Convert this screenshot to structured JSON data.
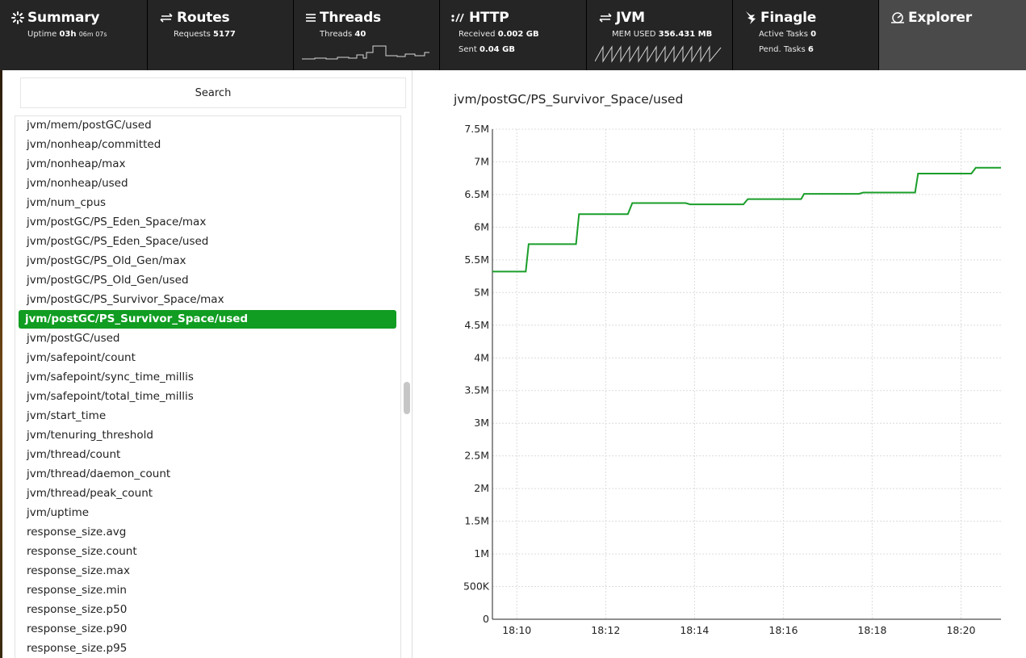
{
  "nav": {
    "summary": {
      "title": "Summary",
      "uptime_label": "Uptime",
      "uptime_main": "03h",
      "uptime_sub": "06m 07s"
    },
    "routes": {
      "title": "Routes",
      "requests_label": "Requests",
      "requests_value": "5177"
    },
    "threads": {
      "title": "Threads",
      "threads_label": "Threads",
      "threads_value": "40"
    },
    "http": {
      "title": "HTTP",
      "received_label": "Received",
      "received_value": "0.002 GB",
      "sent_label": "Sent",
      "sent_value": "0.04 GB"
    },
    "jvm": {
      "title": "JVM",
      "mem_label": "MEM USED",
      "mem_value": "356.431 MB"
    },
    "finagle": {
      "title": "Finagle",
      "active_label": "Active Tasks",
      "active_value": "0",
      "pend_label": "Pend. Tasks",
      "pend_value": "6"
    },
    "explorer": {
      "title": "Explorer"
    }
  },
  "search": {
    "placeholder": "Search"
  },
  "metrics": [
    "jvm/mem/postGC/used",
    "jvm/nonheap/committed",
    "jvm/nonheap/max",
    "jvm/nonheap/used",
    "jvm/num_cpus",
    "jvm/postGC/PS_Eden_Space/max",
    "jvm/postGC/PS_Eden_Space/used",
    "jvm/postGC/PS_Old_Gen/max",
    "jvm/postGC/PS_Old_Gen/used",
    "jvm/postGC/PS_Survivor_Space/max",
    "jvm/postGC/PS_Survivor_Space/used",
    "jvm/postGC/used",
    "jvm/safepoint/count",
    "jvm/safepoint/sync_time_millis",
    "jvm/safepoint/total_time_millis",
    "jvm/start_time",
    "jvm/tenuring_threshold",
    "jvm/thread/count",
    "jvm/thread/daemon_count",
    "jvm/thread/peak_count",
    "jvm/uptime",
    "response_size.avg",
    "response_size.count",
    "response_size.max",
    "response_size.min",
    "response_size.p50",
    "response_size.p90",
    "response_size.p95"
  ],
  "selected_metric": "jvm/postGC/PS_Survivor_Space/used",
  "colors": {
    "accent": "#109d22",
    "line": "#1a9e2a",
    "nav_bg": "#252525",
    "nav_active": "#4a4a4a"
  },
  "chart_data": {
    "type": "line",
    "title": "jvm/postGC/PS_Survivor_Space/used",
    "xlabel": "",
    "ylabel": "",
    "ylim": [
      0,
      7500000
    ],
    "yticks": [
      0,
      500000,
      1000000,
      1500000,
      2000000,
      2500000,
      3000000,
      3500000,
      4000000,
      4500000,
      5000000,
      5500000,
      6000000,
      6500000,
      7000000,
      7500000
    ],
    "ytick_labels": [
      "0",
      "500K",
      "1M",
      "1.5M",
      "2M",
      "2.5M",
      "3M",
      "3.5M",
      "4M",
      "4.5M",
      "5M",
      "5.5M",
      "6M",
      "6.5M",
      "7M",
      "7.5M"
    ],
    "xlim": [
      "18:09:27",
      "18:20:54"
    ],
    "xticks": [
      "18:10:00",
      "18:12:00",
      "18:14:00",
      "18:16:00",
      "18:18:00",
      "18:20:00"
    ],
    "xtick_labels": [
      "18:10",
      "18:12",
      "18:14",
      "18:16",
      "18:18",
      "18:20"
    ],
    "grid": true,
    "series": [
      {
        "x": [
          "18:09:27",
          "18:10:12",
          "18:10:16",
          "18:11:20",
          "18:11:24",
          "18:12:30",
          "18:12:36",
          "18:13:48",
          "18:13:54",
          "18:15:06",
          "18:15:12",
          "18:16:24",
          "18:16:28",
          "18:17:42",
          "18:17:48",
          "18:18:58",
          "18:19:02",
          "18:20:14",
          "18:20:20",
          "18:20:54"
        ],
        "y": [
          5320000,
          5320000,
          5740000,
          5740000,
          6200000,
          6200000,
          6370000,
          6370000,
          6350000,
          6350000,
          6430000,
          6430000,
          6510000,
          6510000,
          6530000,
          6530000,
          6820000,
          6820000,
          6910000,
          6910000
        ]
      }
    ]
  }
}
